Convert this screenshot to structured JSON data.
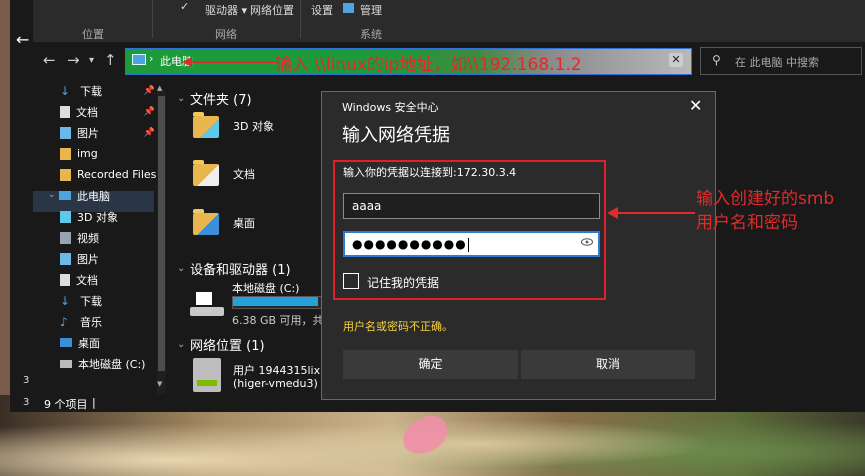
{
  "ribbon": {
    "groups": [
      "位置",
      "网络",
      "系统"
    ],
    "drives_label": "驱动器 ▾",
    "net_location": "网络位置",
    "settings": "设置",
    "manage": "管理"
  },
  "address": {
    "path": "此电脑",
    "search_placeholder": "在 此电脑 中搜索"
  },
  "annotations": {
    "address_hint": "输入 \\\\linux的ip地址，如\\\\192.168.1.2",
    "cred_hint_line1": "输入创建好的smb",
    "cred_hint_line2": "用户名和密码"
  },
  "sidebar": {
    "items": [
      {
        "label": "下载",
        "icon": "download-icon",
        "pinned": true
      },
      {
        "label": "文档",
        "icon": "document-icon",
        "pinned": true
      },
      {
        "label": "图片",
        "icon": "picture-icon",
        "pinned": true
      },
      {
        "label": "img",
        "icon": "folder-icon",
        "pinned": false
      },
      {
        "label": "Recorded Files",
        "icon": "folder-icon",
        "pinned": false
      },
      {
        "label": "此电脑",
        "icon": "computer-icon",
        "pinned": false
      },
      {
        "label": "3D 对象",
        "icon": "cube-icon",
        "pinned": false
      },
      {
        "label": "视频",
        "icon": "video-icon",
        "pinned": false
      },
      {
        "label": "图片",
        "icon": "picture-icon",
        "pinned": false
      },
      {
        "label": "文档",
        "icon": "document-icon",
        "pinned": false
      },
      {
        "label": "下载",
        "icon": "download-icon",
        "pinned": false
      },
      {
        "label": "音乐",
        "icon": "music-icon",
        "pinned": false
      },
      {
        "label": "桌面",
        "icon": "desktop-icon",
        "pinned": false
      },
      {
        "label": "本地磁盘 (C:)",
        "icon": "drive-icon",
        "pinned": false
      }
    ]
  },
  "content": {
    "folders_header": "文件夹 (7)",
    "folders": [
      "3D 对象",
      "文档",
      "桌面"
    ],
    "devices_header": "设备和驱动器 (1)",
    "drive_name": "本地磁盘 (C:)",
    "drive_free": "6.38 GB 可用，共",
    "drive_used_fraction": 0.97,
    "network_header": "网络位置 (1)",
    "network_name": "用户 1944315lixing",
    "network_host": "(higer-vmedu3)"
  },
  "status": {
    "count": "9 个项目",
    "left_num": "3"
  },
  "dialog": {
    "caption": "Windows 安全中心",
    "title": "输入网络凭据",
    "prompt": "输入你的凭据以连接到:172.30.3.4",
    "username": "aaaa",
    "password_mask": "●●●●●●●●●●",
    "remember": "记住我的凭据",
    "error": "用户名或密码不正确。",
    "ok": "确定",
    "cancel": "取消",
    "close": "✕"
  }
}
